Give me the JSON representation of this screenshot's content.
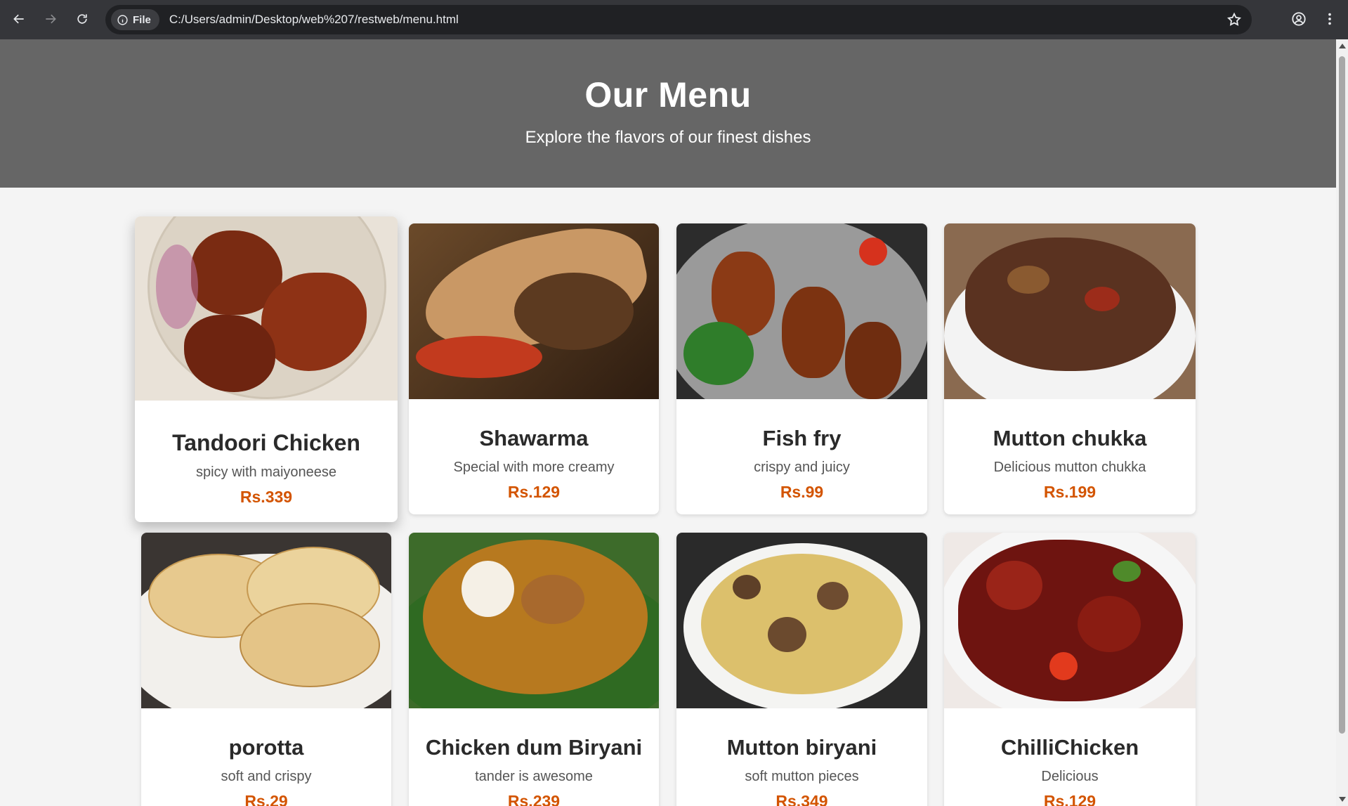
{
  "browser": {
    "chip_label": "File",
    "url": "C:/Users/admin/Desktop/web%207/restweb/menu.html"
  },
  "hero": {
    "title": "Our Menu",
    "subtitle": "Explore the flavors of our finest dishes"
  },
  "menu": [
    {
      "name": "Tandoori Chicken",
      "desc": "spicy with maiyoneese",
      "price": "Rs.339",
      "image": "tandoori-chicken-image"
    },
    {
      "name": "Shawarma",
      "desc": "Special with more creamy",
      "price": "Rs.129",
      "image": "shawarma-image"
    },
    {
      "name": "Fish fry",
      "desc": "crispy and juicy",
      "price": "Rs.99",
      "image": "fish-fry-image"
    },
    {
      "name": "Mutton chukka",
      "desc": "Delicious mutton chukka",
      "price": "Rs.199",
      "image": "mutton-chukka-image"
    },
    {
      "name": "porotta",
      "desc": "soft and crispy",
      "price": "Rs.29",
      "image": "porotta-image"
    },
    {
      "name": "Chicken dum Biryani",
      "desc": "tander is awesome",
      "price": "Rs.239",
      "image": "chicken-biryani-image"
    },
    {
      "name": "Mutton biryani",
      "desc": "soft mutton pieces",
      "price": "Rs.349",
      "image": "mutton-biryani-image"
    },
    {
      "name": "ChilliChicken",
      "desc": "Delicious",
      "price": "Rs.129",
      "image": "chilli-chicken-image"
    }
  ],
  "colors": {
    "hero_bg": "#666666",
    "page_bg": "#f4f4f4",
    "price": "#d35400",
    "chrome_bg": "#35363a"
  }
}
